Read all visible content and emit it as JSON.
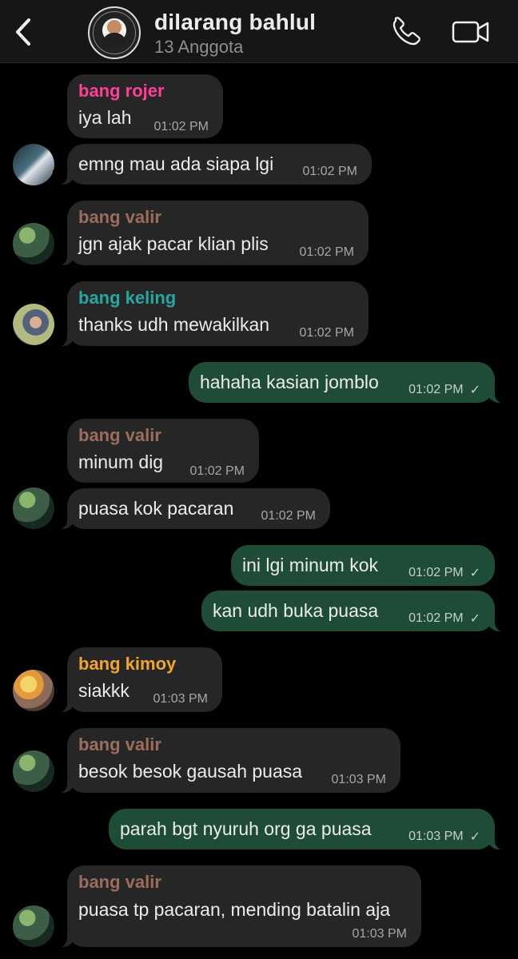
{
  "header": {
    "title": "dilarang bahlul",
    "subtitle": "13 Anggota",
    "back_icon": "chevron-left-icon",
    "call_icon": "phone-icon",
    "video_icon": "video-camera-icon",
    "avatar_label": "group-avatar"
  },
  "colors": {
    "rojer": "#ff3f98",
    "valir": "#9a6d5d",
    "keling": "#24a8a1",
    "kimoy": "#f2a52d",
    "incoming_bubble": "#262626",
    "outgoing_bubble": "#1f4c36"
  },
  "messages": [
    {
      "sender": "bang rojer",
      "text": "iya lah",
      "time": "01:02 PM"
    },
    {
      "sender": "",
      "text": "emng mau ada siapa lgi",
      "time": "01:02 PM"
    },
    {
      "sender": "bang valir",
      "text": "jgn ajak pacar klian plis",
      "time": "01:02 PM"
    },
    {
      "sender": "bang keling",
      "text": "thanks udh mewakilkan",
      "time": "01:02 PM"
    },
    {
      "sender": "",
      "text": "hahaha kasian jomblo",
      "time": "01:02 PM"
    },
    {
      "sender": "bang valir",
      "text": "minum dig",
      "time": "01:02 PM"
    },
    {
      "sender": "",
      "text": "puasa kok pacaran",
      "time": "01:02 PM"
    },
    {
      "sender": "",
      "text": "ini lgi minum kok",
      "time": "01:02 PM"
    },
    {
      "sender": "",
      "text": "kan udh buka puasa",
      "time": "01:02 PM"
    },
    {
      "sender": "bang kimoy",
      "text": "siakkk",
      "time": "01:03 PM"
    },
    {
      "sender": "bang valir",
      "text": "besok besok gausah puasa",
      "time": "01:03 PM"
    },
    {
      "sender": "",
      "text": "parah bgt nyuruh org ga puasa",
      "time": "01:03 PM"
    },
    {
      "sender": "bang valir",
      "text": "puasa tp pacaran, mending batalin aja",
      "time": "01:03 PM"
    }
  ]
}
